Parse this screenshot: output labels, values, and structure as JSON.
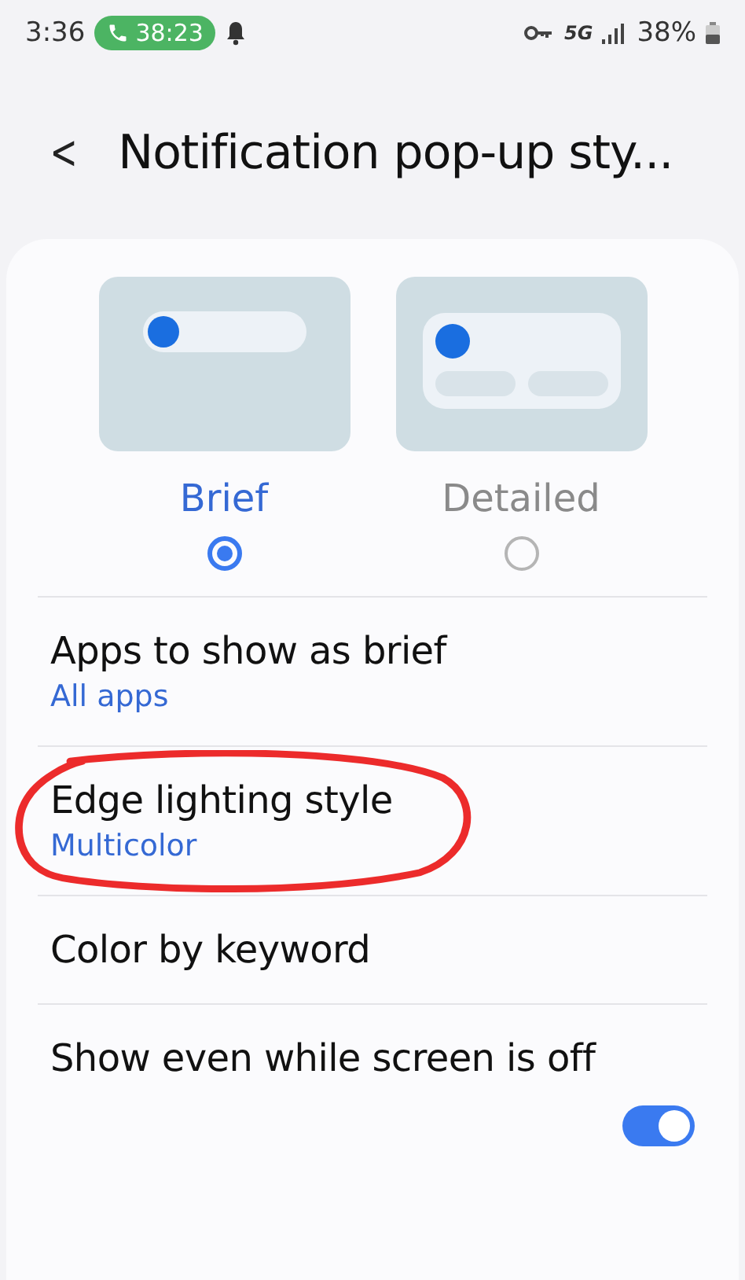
{
  "status_bar": {
    "time": "3:36",
    "call_timer": "38:23",
    "network": "5G",
    "battery": "38%"
  },
  "header": {
    "back": "<",
    "title": "Notification pop-up sty..."
  },
  "styles": [
    {
      "kind": "brief",
      "label": "Brief",
      "selected": true
    },
    {
      "kind": "detailed",
      "label": "Detailed",
      "selected": false
    }
  ],
  "settings": [
    {
      "kind": "link",
      "title": "Apps to show as brief",
      "value": "All apps",
      "highlighted": false
    },
    {
      "kind": "link",
      "title": "Edge lighting style",
      "value": "Multicolor",
      "highlighted": true
    },
    {
      "kind": "link",
      "title": "Color by keyword",
      "highlighted": false
    },
    {
      "kind": "switch",
      "title": "Show even while screen is off",
      "on": true,
      "highlighted": false
    }
  ]
}
